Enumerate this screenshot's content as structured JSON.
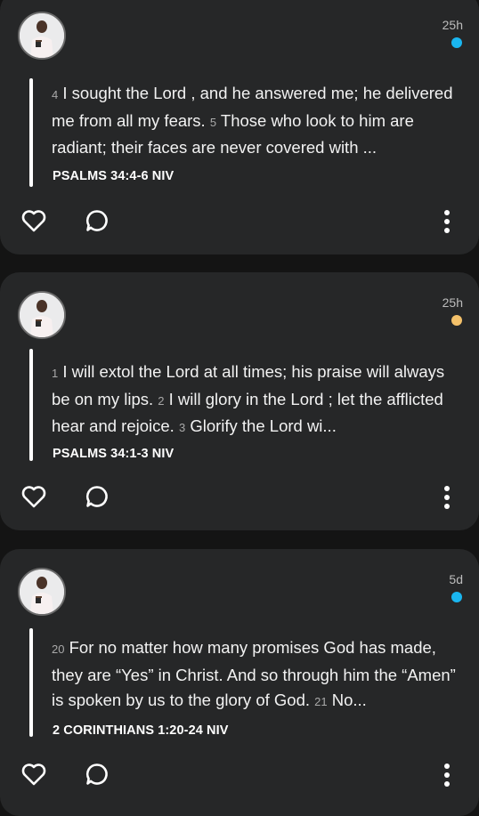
{
  "posts": [
    {
      "time": "25h",
      "dot_color": "#1ab6f0",
      "verse": [
        {
          "n": "4",
          "t": "I sought the Lord , and he answered me; he delivered me from all my fears."
        },
        {
          "n": "5",
          "t": "Those who look to him are radiant; their faces are never covered with ..."
        }
      ],
      "reference": "PSALMS 34:4-6 NIV",
      "icons": [
        "heart-icon",
        "comment-icon",
        "more-options-icon"
      ]
    },
    {
      "time": "25h",
      "dot_color": "#f4c16a",
      "verse": [
        {
          "n": "1",
          "t": "I will extol the Lord at all times; his praise will always be on my lips."
        },
        {
          "n": "2",
          "t": "I will glory in the Lord ; let the afflicted hear and rejoice."
        },
        {
          "n": "3",
          "t": "Glorify the Lord wi..."
        }
      ],
      "reference": "PSALMS 34:1-3 NIV",
      "icons": [
        "heart-icon",
        "comment-icon",
        "more-options-icon"
      ]
    },
    {
      "time": "5d",
      "dot_color": "#1ab6f0",
      "verse": [
        {
          "n": "20",
          "t": "For no matter how many promises God has made, they are “Yes” in Christ. And so through him the “Amen” is spoken by us to the glory of God."
        },
        {
          "n": "21",
          "t": "No..."
        }
      ],
      "reference": "2 CORINTHIANS 1:20-24 NIV",
      "icons": [
        "heart-icon",
        "comment-icon",
        "more-options-icon"
      ]
    }
  ]
}
